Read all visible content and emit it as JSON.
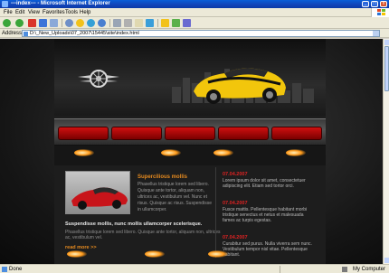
{
  "window": {
    "title": "---index--- - Microsoft Internet Explorer"
  },
  "menu": [
    "File",
    "Edit",
    "View",
    "Favorites",
    "Tools",
    "Help"
  ],
  "address": {
    "label": "Address",
    "url": "D:\\_New_Uploads\\07_2007\\15445\\site\\index.html"
  },
  "status": {
    "text": "Done",
    "zone": "My Computer"
  },
  "site": {
    "feature": {
      "title": "Supercilious mollis",
      "text": "Phasellus tristique lorem sed libero. Quisque ante tortor, aliquam non, ultrices ac, vestibulum vel. Nunc et risus. Quisque ac risus. Suspendisse in ullamcorper."
    },
    "subhead": "Suspendisse mollis, nunc mollis ullamcorper scelerisque.",
    "body": "Phasellus tristique lorem sed libero. Quisque ante tortor, aliquam non, ultrices ac, vestibulum vel.",
    "readmore": "read more >>",
    "news": [
      {
        "date": "07.04.2007",
        "text": "Lorem ipsum dolor sit amet, consectetuer adipiscing elit. Etiam sed tortor orci."
      },
      {
        "date": "07.04.2007",
        "text": "Fusce mattis. Pellentesque habitant morbi tristique senectus et netus et malesuada fames ac turpis egestas."
      },
      {
        "date": "07.04.2007",
        "text": "Curabitur sed purus. Nulla viverra sem nunc. Vestibulum tempor nisl vitae. Pellentesque habitant."
      }
    ]
  },
  "colors": {
    "accent": "#e58a1f",
    "nav_red": "#c21010",
    "date_red": "#dd2222"
  }
}
